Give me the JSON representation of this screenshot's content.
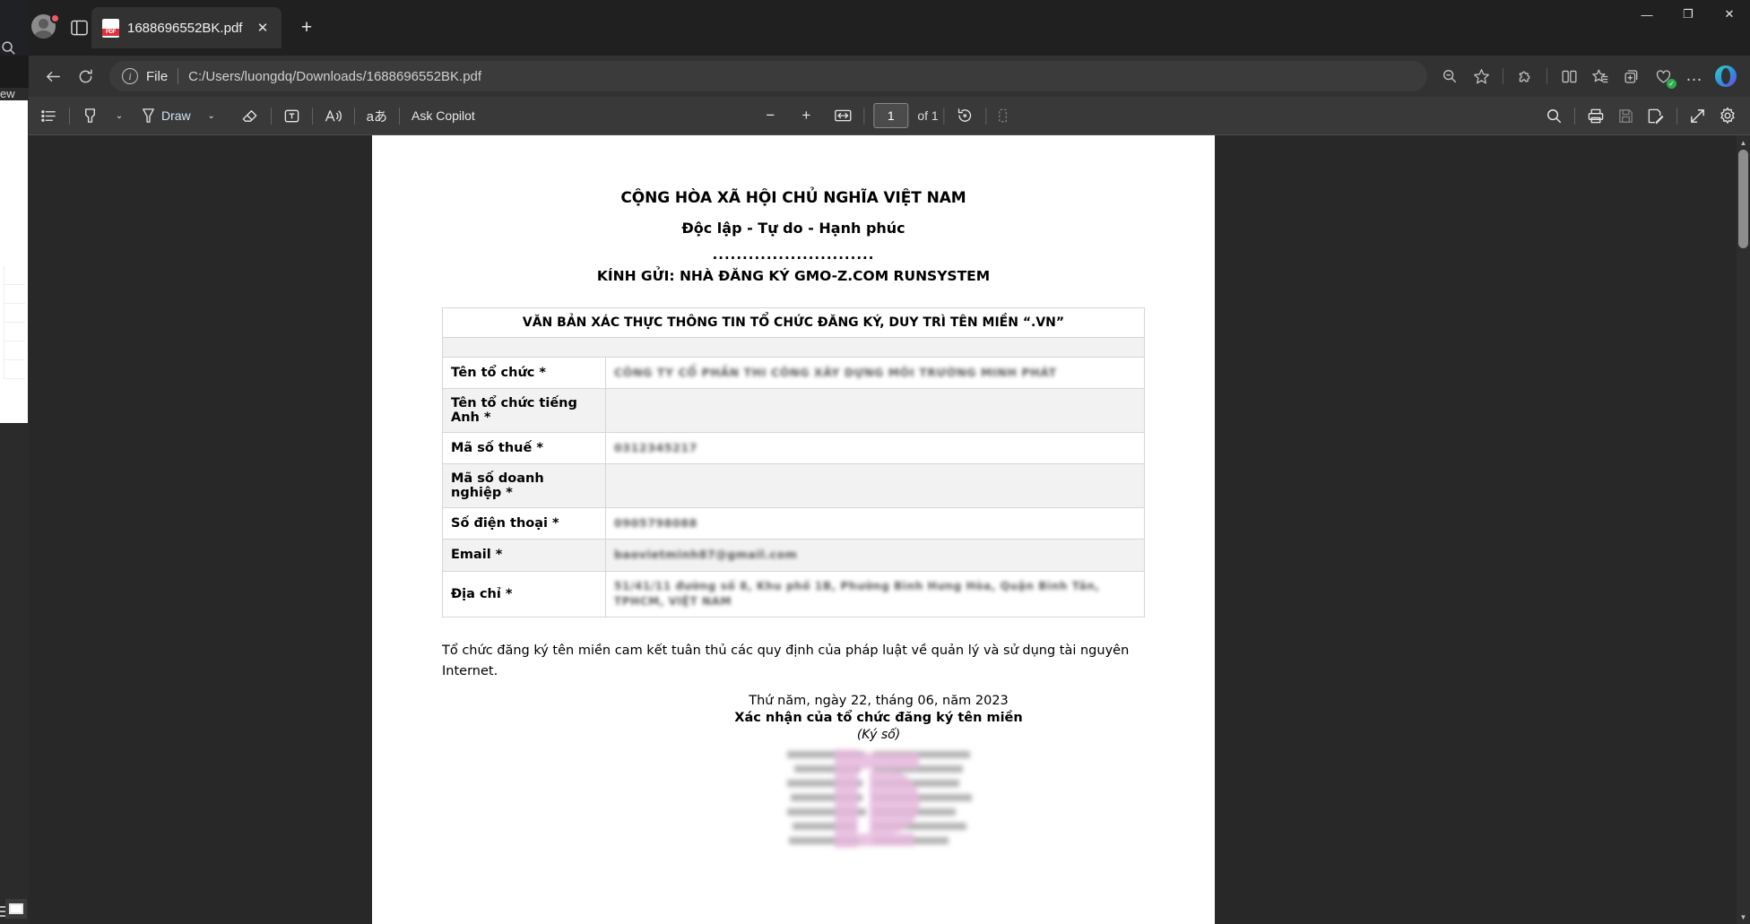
{
  "browser": {
    "tab": {
      "title": "1688696552BK.pdf",
      "favicon": "pdf-file-icon",
      "close": "✕"
    },
    "new_tab": "+",
    "window_controls": {
      "minimize": "—",
      "maximize": "❐",
      "close": "✕"
    },
    "address": {
      "back": "←",
      "refresh": "⟳",
      "info_icon": "i",
      "scheme_label": "File",
      "url": "C:/Users/luongdq/Downloads/1688696552BK.pdf",
      "zoom_out_icon": "zoom-out-icon",
      "favorite_icon": "star-icon",
      "extensions_icon": "puzzle-icon",
      "split_screen_icon": "split-screen-icon",
      "collections_icon": "collections-icon",
      "add_tab_group_icon": "add-tab-group-icon",
      "browser_essentials_icon": "browser-essentials-icon",
      "settings_more_icon": "…",
      "copilot_icon": "copilot-icon"
    }
  },
  "background_window": {
    "tab_label": "ew",
    "search_icon": "search-icon",
    "taskbar_icon": "window-icon"
  },
  "pdf_toolbar": {
    "left": [
      {
        "name": "toc-icon",
        "label": ""
      },
      {
        "name": "highlight-icon",
        "label": ""
      },
      {
        "name": "highlight-caret",
        "label": "⌄"
      },
      {
        "name": "draw-icon",
        "label": ""
      },
      {
        "name": "draw-label",
        "label": "Draw"
      },
      {
        "name": "draw-caret",
        "label": "⌄"
      },
      {
        "name": "erase-icon",
        "label": ""
      },
      {
        "name": "add-text-icon",
        "label": ""
      },
      {
        "name": "read-aloud-icon",
        "label": ""
      },
      {
        "name": "translate-icon",
        "label": "aあ"
      }
    ],
    "ask_copilot": "Ask Copilot",
    "zoom_out": "−",
    "zoom_in": "+",
    "fit_page_icon": "fit-page-icon",
    "page_number": "1",
    "page_total": "of 1",
    "rotate_icon": "rotate-icon",
    "layout_icon": "page-layout-icon",
    "right": [
      {
        "name": "search-icon",
        "label": ""
      },
      {
        "name": "print-icon",
        "label": ""
      },
      {
        "name": "save-icon",
        "label": ""
      },
      {
        "name": "save-as-icon",
        "label": ""
      },
      {
        "name": "fullscreen-icon",
        "label": ""
      },
      {
        "name": "settings-icon",
        "label": ""
      }
    ]
  },
  "document": {
    "heading_1": "CỘNG HÒA XÃ HỘI CHỦ NGHĨA VIỆT NAM",
    "heading_2": "Độc lập - Tự do - Hạnh phúc",
    "dots": "...........................",
    "heading_3": "KÍNH GỬI: NHÀ ĐĂNG KÝ GMO-Z.COM RUNSYSTEM",
    "table_title": "VĂN BẢN XÁC THỰC THÔNG TIN TỔ CHỨC ĐĂNG KÝ, DUY TRÌ TÊN MIỀN “.VN”",
    "rows": [
      {
        "label": "Tên tổ chức *",
        "value": "CÔNG TY CỔ PHẦN THI CÔNG XÂY DỰNG MÔI TRƯỜNG MINH PHÁT",
        "redacted": true
      },
      {
        "label": "Tên tổ chức tiếng Anh *",
        "value": "",
        "redacted": false
      },
      {
        "label": "Mã số thuế *",
        "value": "0312345217",
        "redacted": true
      },
      {
        "label": "Mã số doanh nghiệp *",
        "value": "",
        "redacted": false
      },
      {
        "label": "Số điện thoại *",
        "value": "0905798088",
        "redacted": true
      },
      {
        "label": "Email *",
        "value": "baovietminh87@gmail.com",
        "redacted": true
      },
      {
        "label": "Địa chỉ *",
        "value": "51/41/11 đường số 8, Khu phố 1B, Phường Bình Hưng Hòa, Quận Bình Tân, TPHCM, VIỆT NAM",
        "redacted": true
      }
    ],
    "paragraph": "Tổ chức đăng ký tên miền cam kết tuân thủ các quy định của pháp luật về quản lý và sử dụng tài nguyên Internet.",
    "sign_date": "Thứ năm,  ngày 22, tháng 06, năm 2023",
    "sign_title": "Xác nhận của tổ chức đăng ký tên miền",
    "sign_note": "(Ký số)",
    "stamp": "digital-signature-stamp"
  },
  "colors": {
    "chrome_bg": "#202020",
    "addressbar_bg": "#323232",
    "toolbar_bg": "#393939",
    "viewer_bg": "#282828",
    "page_bg": "#ffffff",
    "tab_active": "#323232",
    "link_blue": "#cfcfcf",
    "notification_dot": "#f05a67",
    "stamp_pink": "#e6b9dd"
  }
}
